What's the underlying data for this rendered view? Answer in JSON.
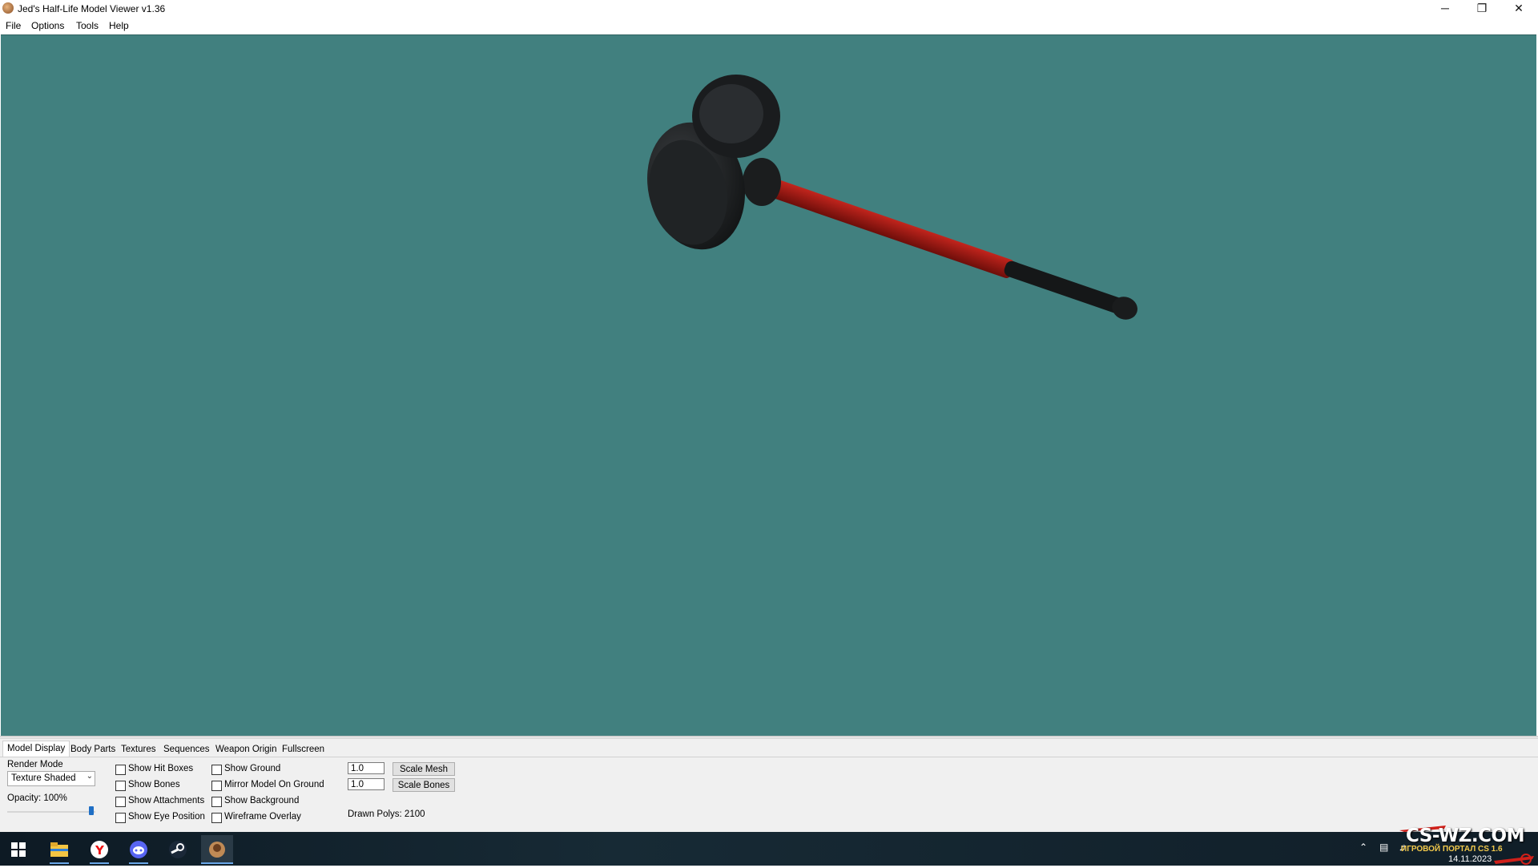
{
  "window": {
    "title": "Jed's Half-Life Model Viewer v1.36",
    "controls": [
      "─",
      "❐",
      "✕"
    ]
  },
  "menu": [
    "File",
    "Options",
    "Tools",
    "Help"
  ],
  "viewport": {
    "background": "#41807f",
    "model": "sledgehammer-model"
  },
  "tabs": [
    "Model Display",
    "Body Parts",
    "Textures",
    "Sequences",
    "Weapon Origin",
    "Fullscreen"
  ],
  "panel": {
    "render_mode_label": "Render Mode",
    "render_mode_value": "Texture Shaded",
    "opacity_label": "Opacity: 100%",
    "opacity_value": 1.0,
    "checkboxes_col1": [
      "Show Hit Boxes",
      "Show Bones",
      "Show Attachments",
      "Show Eye Position"
    ],
    "checkboxes_col2": [
      "Show Ground",
      "Mirror Model On Ground",
      "Show Background",
      "Wireframe Overlay"
    ],
    "scale_mesh_value": "1.0",
    "scale_mesh_label": "Scale Mesh",
    "scale_bones_value": "1.0",
    "scale_bones_label": "Scale Bones",
    "drawn_polys": "Drawn Polys: 2100"
  },
  "taskbar": {
    "icons": [
      "windows-start-icon",
      "file-explorer-icon",
      "yandex-browser-icon",
      "discord-icon",
      "steam-icon",
      "model-viewer-icon"
    ]
  },
  "watermark": {
    "brand": "CS-WZ.COM",
    "tagline": "ИГРОВОЙ ПОРТАЛ CS 1.6",
    "date": "14.11.2023"
  }
}
